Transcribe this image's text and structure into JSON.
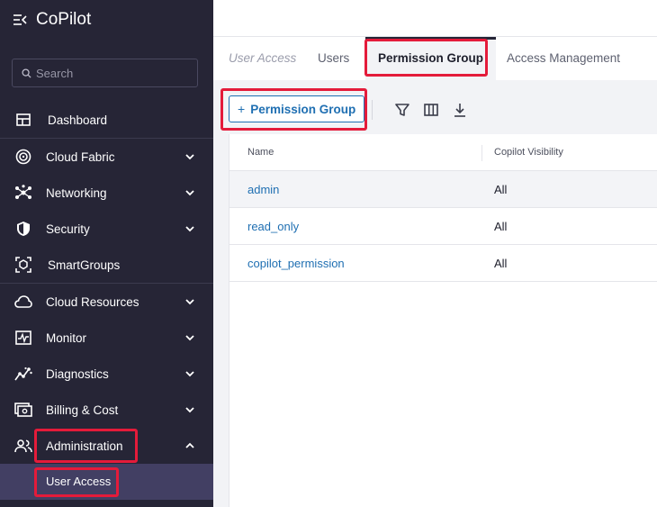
{
  "app": {
    "title": "CoPilot"
  },
  "search": {
    "placeholder": "Search"
  },
  "sidebar": {
    "items": [
      {
        "label": "Dashboard"
      },
      {
        "label": "Cloud Fabric"
      },
      {
        "label": "Networking"
      },
      {
        "label": "Security"
      },
      {
        "label": "SmartGroups"
      },
      {
        "label": "Cloud Resources"
      },
      {
        "label": "Monitor"
      },
      {
        "label": "Diagnostics"
      },
      {
        "label": "Billing & Cost"
      },
      {
        "label": "Administration"
      }
    ],
    "sub_items": [
      {
        "label": "User Access"
      }
    ]
  },
  "tabs": {
    "breadcrumb": "User Access",
    "items": [
      {
        "label": "Users"
      },
      {
        "label": "Permission Group"
      },
      {
        "label": "Access Management"
      }
    ],
    "active": "Permission Group"
  },
  "toolbar": {
    "add_label": "Permission Group",
    "add_prefix": "+",
    "icons": [
      "filter-icon",
      "columns-icon",
      "download-icon"
    ]
  },
  "table": {
    "columns": [
      "Name",
      "Copilot Visibility"
    ],
    "rows": [
      {
        "name": "admin",
        "visibility": "All"
      },
      {
        "name": "read_only",
        "visibility": "All"
      },
      {
        "name": "copilot_permission",
        "visibility": "All"
      }
    ]
  },
  "colors": {
    "sidebar_bg": "#262536",
    "highlight": "#e41b3a",
    "link": "#1f6fb2",
    "active_sub_bg": "#423f63"
  }
}
